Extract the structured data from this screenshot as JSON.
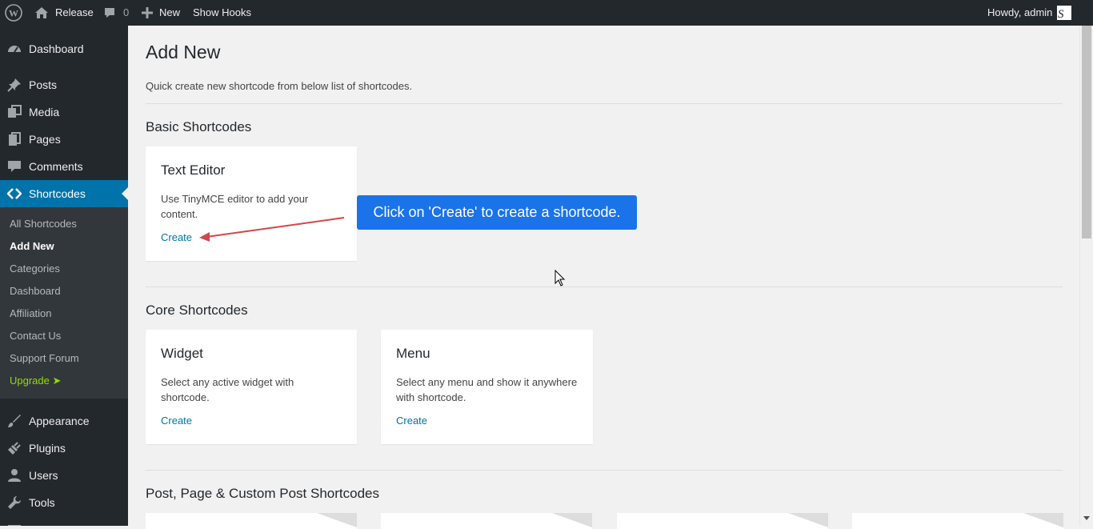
{
  "adminbar": {
    "wp_logo": "wordpress-logo-icon",
    "site_name": "Release",
    "comments_count": "0",
    "new_label": "New",
    "show_hooks_label": "Show Hooks",
    "howdy": "Howdy, admin"
  },
  "sidebar": {
    "dashboard": "Dashboard",
    "posts": "Posts",
    "media": "Media",
    "pages": "Pages",
    "comments": "Comments",
    "shortcodes": "Shortcodes",
    "submenu": {
      "all": "All Shortcodes",
      "add_new": "Add New",
      "categories": "Categories",
      "dashboard": "Dashboard",
      "affiliation": "Affiliation",
      "contact": "Contact Us",
      "support": "Support Forum",
      "upgrade": "Upgrade ➤"
    },
    "appearance": "Appearance",
    "plugins": "Plugins",
    "users": "Users",
    "tools": "Tools"
  },
  "main": {
    "title": "Add New",
    "subtitle": "Quick create new shortcode from below list of shortcodes.",
    "basic_title": "Basic Shortcodes",
    "core_title": "Core Shortcodes",
    "post_title": "Post, Page & Custom Post Shortcodes",
    "cards": {
      "text_editor": {
        "title": "Text Editor",
        "desc": "Use TinyMCE editor to add your content.",
        "link": "Create"
      },
      "widget": {
        "title": "Widget",
        "desc": "Select any active widget with shortcode.",
        "link": "Create"
      },
      "menu": {
        "title": "Menu",
        "desc": "Select any menu and show it anywhere with shortcode.",
        "link": "Create"
      }
    }
  },
  "tooltip": "Click on 'Create' to create a shortcode.",
  "colors": {
    "accent": "#0073aa",
    "tooltip": "#1a73e8",
    "upgrade": "#8fde00",
    "annotation_arrow": "#d04848"
  }
}
